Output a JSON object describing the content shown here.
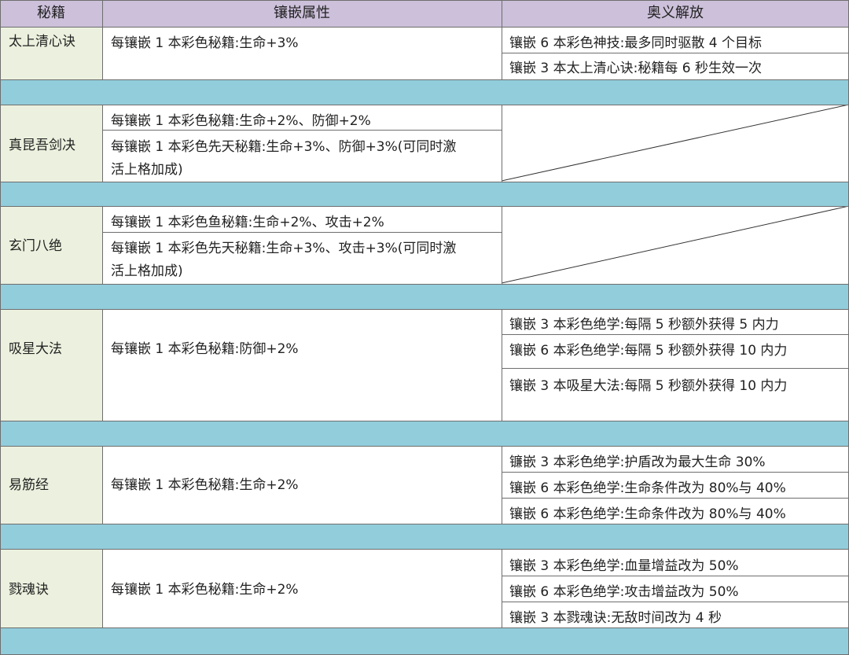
{
  "header": {
    "col1": "秘籍",
    "col2": "镶嵌属性",
    "col3": "奥义解放"
  },
  "rows": [
    {
      "name": "太上清心诀",
      "attrs": [
        "每镶嵌 1 本彩色秘籍:生命+3%"
      ],
      "aoyi": [
        "镶嵌 6 本彩色神技:最多同时驱散 4 个目标",
        "镶嵌 3 本太上清心诀:秘籍每 6 秒生效一次"
      ]
    },
    {
      "name": "真昆吾剑决",
      "attrs": [
        "每镶嵌 1 本彩色秘籍:生命+2%、防御+2%",
        "每镶嵌 1 本彩色先天秘籍:生命+3%、防御+3%(可同时激",
        "活上格加成)"
      ],
      "aoyi": []
    },
    {
      "name": "玄门八绝",
      "attrs": [
        "每镶嵌 1 本彩色鱼秘籍:生命+2%、攻击+2%",
        "每镶嵌 1 本彩色先天秘籍:生命+3%、攻击+3%(可同时激",
        "活上格加成)"
      ],
      "aoyi": []
    },
    {
      "name": "吸星大法",
      "attrs": [
        "每镶嵌 1 本彩色秘籍:防御+2%"
      ],
      "aoyi": [
        "镶嵌 3 本彩色绝学:每隔 5 秒额外获得 5 内力",
        "镶嵌 6 本彩色绝学:每隔 5 秒额外获得 10  内力",
        "镶嵌 3 本吸星大法:每隔 5 秒额外获得  10  内力"
      ]
    },
    {
      "name": "易筋经",
      "attrs": [
        "每镶嵌 1 本彩色秘籍:生命+2%"
      ],
      "aoyi": [
        "镰嵌 3 本彩色绝学:护盾改为最大生命  30%",
        "镶嵌 6 本彩色绝学:生命条件改为 80%与 40%",
        "镶嵌 6 本彩色绝学:生命条件改为  80%与 40%"
      ]
    },
    {
      "name": "戮魂诀",
      "attrs": [
        "每镶嵌 1 本彩色秘籍:生命+2%"
      ],
      "aoyi": [
        "镶嵌 3 本彩色绝学:血量增益改为  50%",
        "镶嵌 6 本彩色绝学:攻击增益改为  50%",
        "镶嵌 3 本戮魂诀:无敌时间改为 4 秒"
      ]
    }
  ],
  "colors": {
    "header": "#ccc0da",
    "name_col": "#ebf1de",
    "separator": "#92cddc",
    "grid": "#6e6e6e"
  }
}
